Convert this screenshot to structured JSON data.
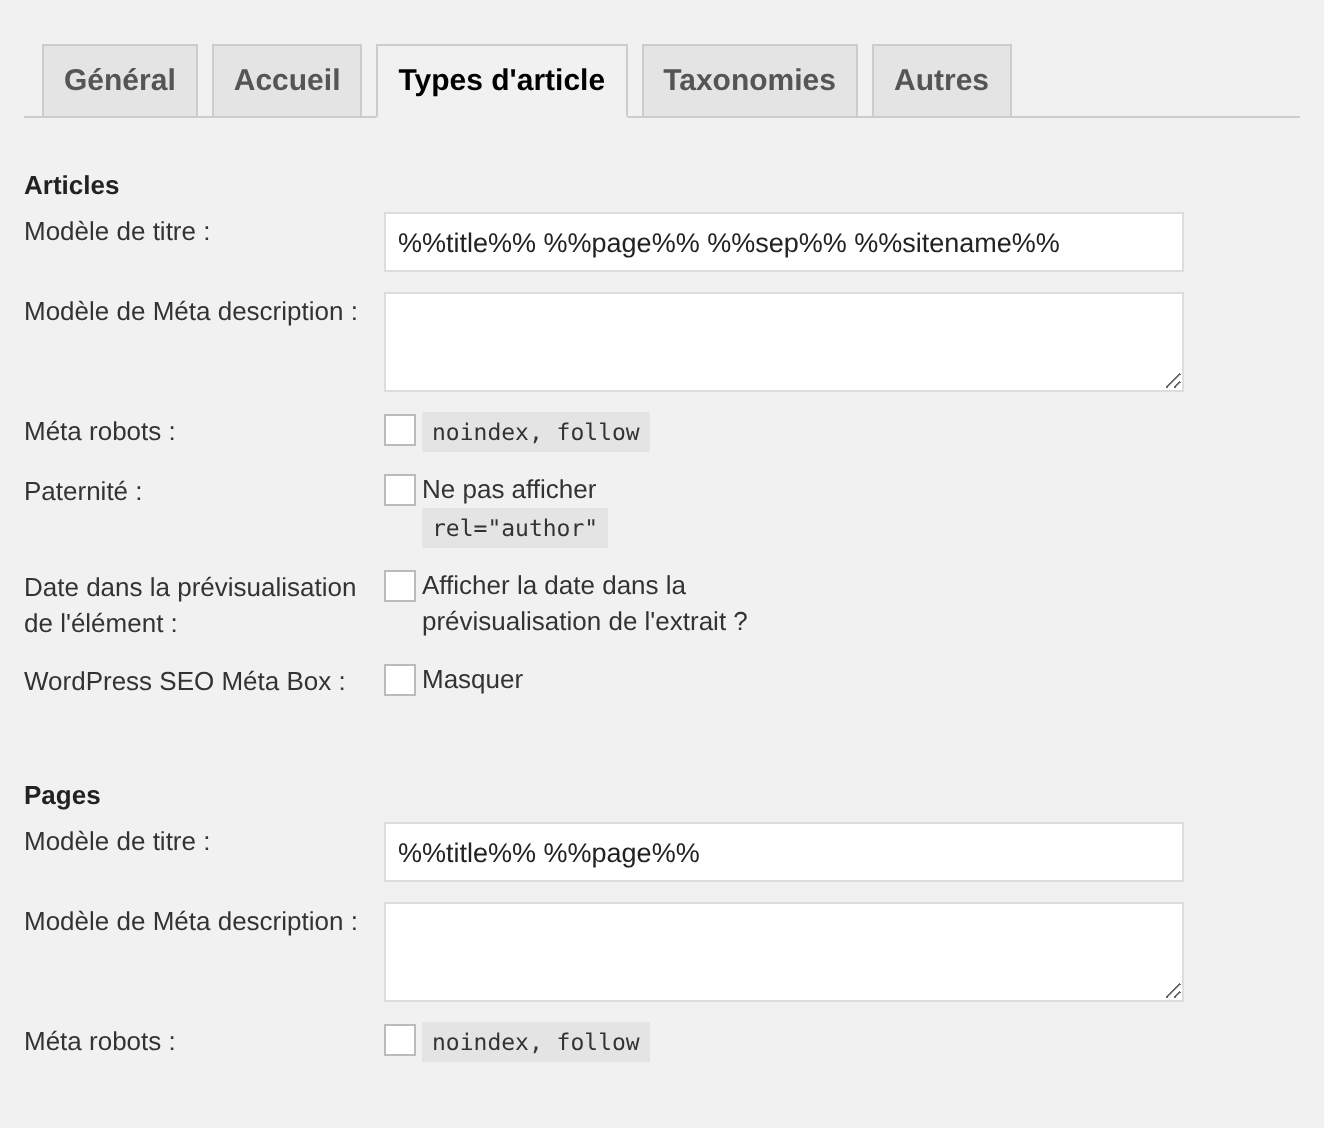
{
  "tabs": [
    {
      "label": "Général",
      "selected": false
    },
    {
      "label": "Accueil",
      "selected": false
    },
    {
      "label": "Types d'article",
      "selected": true
    },
    {
      "label": "Taxonomies",
      "selected": false
    },
    {
      "label": "Autres",
      "selected": false
    }
  ],
  "sections": [
    {
      "heading": "Articles",
      "fields": [
        {
          "kind": "text",
          "label": "Modèle de titre :",
          "value": "%%title%% %%page%% %%sep%% %%sitename%%"
        },
        {
          "kind": "textarea",
          "label": "Modèle de Méta description :"
        },
        {
          "kind": "checkbox",
          "label": "Méta robots :",
          "checked": false,
          "option": [
            {
              "kind": "code",
              "text": "noindex, follow"
            }
          ]
        },
        {
          "kind": "checkbox",
          "label": "Paternité :",
          "checked": false,
          "option": [
            {
              "kind": "text",
              "text": "Ne pas afficher"
            },
            {
              "kind": "code",
              "text": "rel=\"author\""
            }
          ]
        },
        {
          "kind": "checkbox",
          "label": "Date dans la prévisualisation de l'élément :",
          "checked": false,
          "option": [
            {
              "kind": "text",
              "text": "Afficher la date dans la prévisualisation de l'extrait ?"
            }
          ]
        },
        {
          "kind": "checkbox",
          "label": "WordPress SEO Méta Box :",
          "checked": false,
          "option": [
            {
              "kind": "text",
              "text": "Masquer"
            }
          ]
        }
      ]
    },
    {
      "heading": "Pages",
      "fields": [
        {
          "kind": "text",
          "label": "Modèle de titre :",
          "value": "%%title%% %%page%%"
        },
        {
          "kind": "textarea",
          "label": "Modèle de Méta description :"
        },
        {
          "kind": "checkbox",
          "label": "Méta robots :",
          "checked": false,
          "option": [
            {
              "kind": "code",
              "text": "noindex, follow"
            }
          ]
        }
      ]
    }
  ]
}
